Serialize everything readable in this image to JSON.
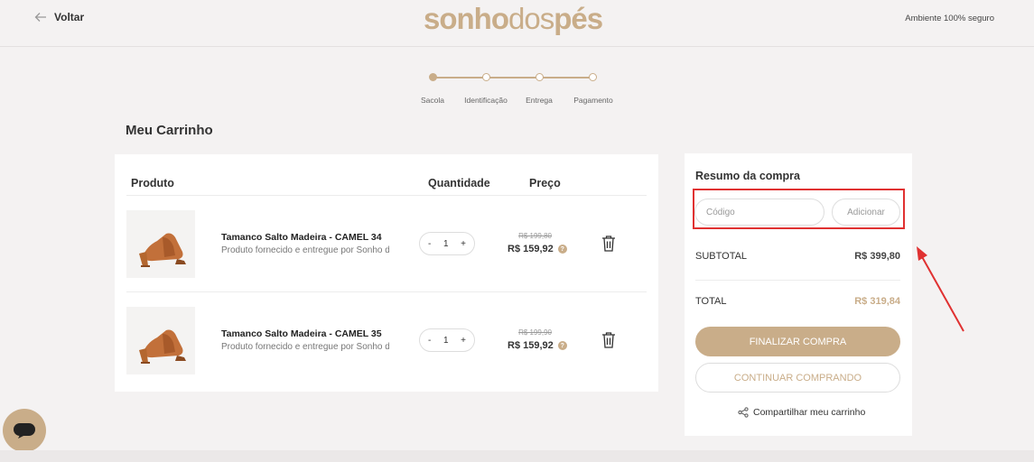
{
  "header": {
    "back_label": "Voltar",
    "logo_bold": "sonho",
    "logo_thin": "dos",
    "logo_bold2": "pés",
    "secure_label": "Ambiente 100% seguro"
  },
  "steps": [
    "Sacola",
    "Identificação",
    "Entrega",
    "Pagamento"
  ],
  "page_title": "Meu Carrinho",
  "cart": {
    "col_product": "Produto",
    "col_qty": "Quantidade",
    "col_price": "Preço",
    "items": [
      {
        "name": "Tamanco Salto Madeira - CAMEL 34",
        "description": "Produto fornecido e entregue por Sonho dos Pés",
        "quantity": "1",
        "minus": "-",
        "plus": "+",
        "old_price": "R$ 199,80",
        "price": "R$ 159,92"
      },
      {
        "name": "Tamanco Salto Madeira - CAMEL 35",
        "description": "Produto fornecido e entregue por Sonho dos Pés",
        "quantity": "1",
        "minus": "-",
        "plus": "+",
        "old_price": "R$ 199,90",
        "price": "R$ 159,92"
      }
    ]
  },
  "summary": {
    "title": "Resumo da compra",
    "coupon_placeholder": "Código",
    "add_label": "Adicionar",
    "subtotal_label": "SUBTOTAL",
    "subtotal_value": "R$ 399,80",
    "total_label": "TOTAL",
    "total_value": "R$ 319,84",
    "checkout_label": "FINALIZAR COMPRA",
    "continue_label": "CONTINUAR COMPRANDO",
    "share_label": "Compartilhar meu carrinho"
  },
  "colors": {
    "accent": "#c9ad89",
    "annotation": "#e03131"
  }
}
